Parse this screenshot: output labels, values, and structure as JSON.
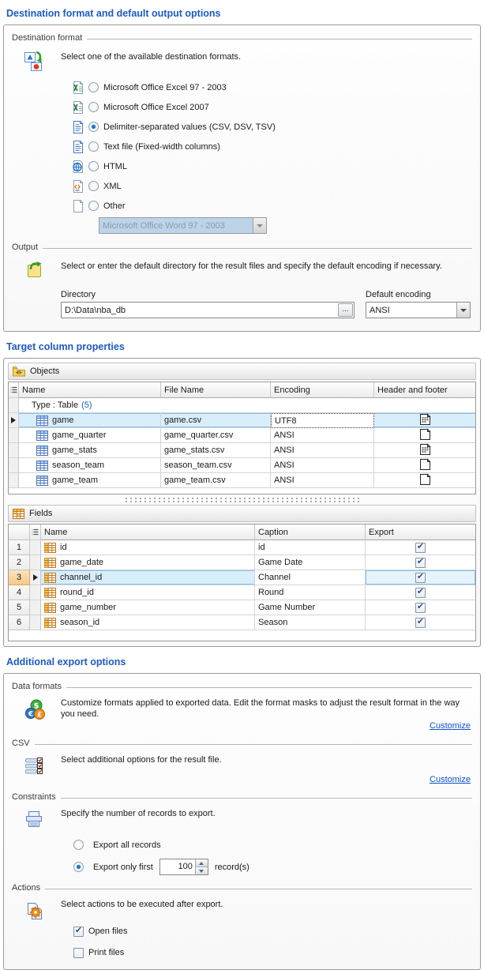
{
  "destination": {
    "heading": "Destination format and default output options",
    "group_format": "Destination format",
    "format_prompt": "Select one of the available destination formats.",
    "formats": [
      {
        "label": "Microsoft Office Excel 97 - 2003",
        "icon": "excel-icon",
        "selected": false
      },
      {
        "label": "Microsoft Office Excel 2007",
        "icon": "excel-icon",
        "selected": false
      },
      {
        "label": "Delimiter-separated values (CSV, DSV, TSV)",
        "icon": "text-doc-icon",
        "selected": true
      },
      {
        "label": "Text file (Fixed-width columns)",
        "icon": "text-doc-icon",
        "selected": false
      },
      {
        "label": "HTML",
        "icon": "html-doc-icon",
        "selected": false
      },
      {
        "label": "XML",
        "icon": "xml-doc-icon",
        "selected": false
      },
      {
        "label": "Other",
        "icon": "blank-doc-icon",
        "selected": false
      }
    ],
    "other_format_value": "Microsoft Office Word 97 - 2003",
    "group_output": "Output",
    "output_prompt": "Select or enter the default directory for the result files and specify the default encoding if necessary.",
    "directory_label": "Directory",
    "directory_value": "D:\\Data\\nba_db",
    "browse_label": "...",
    "encoding_label": "Default encoding",
    "encoding_value": "ANSI"
  },
  "target": {
    "heading": "Target column properties",
    "objects_title": "Objects",
    "objects_columns": [
      "Name",
      "File Name",
      "Encoding",
      "Header and footer"
    ],
    "group_row": {
      "prefix": "Type : Table",
      "count": "(5)"
    },
    "objects_rows": [
      {
        "name": "game",
        "file": "game.csv",
        "encoding": "UTF8",
        "hf_lines": true,
        "selected": true
      },
      {
        "name": "game_quarter",
        "file": "game_quarter.csv",
        "encoding": "ANSI",
        "hf_lines": false,
        "selected": false
      },
      {
        "name": "game_stats",
        "file": "game_stats.csv",
        "encoding": "ANSI",
        "hf_lines": true,
        "selected": false
      },
      {
        "name": "season_team",
        "file": "season_team.csv",
        "encoding": "ANSI",
        "hf_lines": false,
        "selected": false
      },
      {
        "name": "game_team",
        "file": "game_team.csv",
        "encoding": "ANSI",
        "hf_lines": false,
        "selected": false
      }
    ],
    "fields_title": "Fields",
    "fields_columns": [
      "Name",
      "Caption",
      "Export"
    ],
    "fields_rows": [
      {
        "num": "1",
        "name": "id",
        "caption": "id",
        "export": true,
        "selected": false
      },
      {
        "num": "2",
        "name": "game_date",
        "caption": "Game Date",
        "export": true,
        "selected": false
      },
      {
        "num": "3",
        "name": "channel_id",
        "caption": "Channel",
        "export": true,
        "selected": true
      },
      {
        "num": "4",
        "name": "round_id",
        "caption": "Round",
        "export": true,
        "selected": false
      },
      {
        "num": "5",
        "name": "game_number",
        "caption": "Game Number",
        "export": true,
        "selected": false
      },
      {
        "num": "6",
        "name": "season_id",
        "caption": "Season",
        "export": true,
        "selected": false
      }
    ]
  },
  "additional": {
    "heading": "Additional export options",
    "data_formats": {
      "label": "Data formats",
      "desc": "Customize formats applied to exported data. Edit the format masks to adjust the result format in the way you need.",
      "link": "Customize"
    },
    "csv": {
      "label": "CSV",
      "desc": "Select additional options for the result file.",
      "link": "Customize"
    },
    "constraints": {
      "label": "Constraints",
      "desc": "Specify the number of records to export.",
      "export_all_label": "Export all records",
      "export_all_selected": false,
      "export_first_label": "Export only first",
      "export_first_selected": true,
      "count_value": "100",
      "records_suffix": "record(s)"
    },
    "actions": {
      "label": "Actions",
      "desc": "Select actions to be executed after export.",
      "open_files_label": "Open files",
      "open_files_checked": true,
      "print_files_label": "Print files",
      "print_files_checked": false
    }
  }
}
